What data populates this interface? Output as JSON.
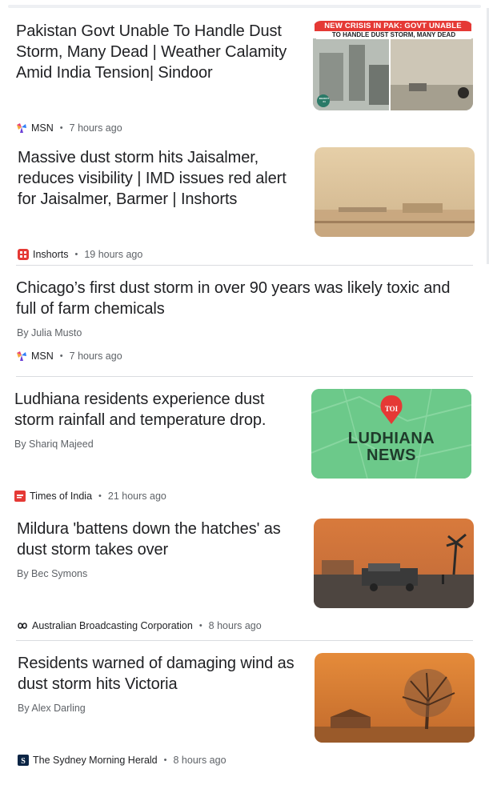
{
  "articles": [
    {
      "headline": "Pakistan Govt Unable To Handle Dust Storm, Many Dead | Weather Calamity Amid India Tension| Sindoor",
      "source": "MSN",
      "time": "7 hours ago",
      "thumb_banner_line1": "NEW CRISIS IN PAK: GOVT UNABLE",
      "thumb_banner_line2": "TO HANDLE DUST STORM, MANY DEAD",
      "thumb_logo": "BHARAT 24"
    },
    {
      "headline": "Massive dust storm hits Jaisalmer, reduces visibility | IMD issues red alert for Jaisalmer, Barmer | Inshorts",
      "source": "Inshorts",
      "time": "19 hours ago"
    },
    {
      "headline": "Chicago’s first dust storm in over 90 years was likely toxic and full of farm chemicals",
      "byline": "By Julia Musto",
      "source": "MSN",
      "time": "7 hours ago"
    },
    {
      "headline": "Ludhiana residents experience dust storm rainfall and temperature drop.",
      "byline": "By Shariq Majeed",
      "source": "Times of India",
      "time": "21 hours ago",
      "thumb_pin": "TOI",
      "thumb_line1": "LUDHIANA",
      "thumb_line2": "NEWS"
    },
    {
      "headline": "Mildura 'battens down the hatches' as dust storm takes over",
      "byline": "By Bec Symons",
      "source": "Australian Broadcasting Corporation",
      "time": "8 hours ago"
    },
    {
      "headline": "Residents warned of damaging wind as dust storm hits Victoria",
      "byline": "By Alex Darling",
      "source": "The Sydney Morning Herald",
      "time": "8 hours ago"
    }
  ],
  "separator": "•",
  "colors": {
    "headline": "#202124",
    "meta": "#5f6368",
    "ludhiana_green": "#6cc98a",
    "toi_red": "#e53935"
  }
}
